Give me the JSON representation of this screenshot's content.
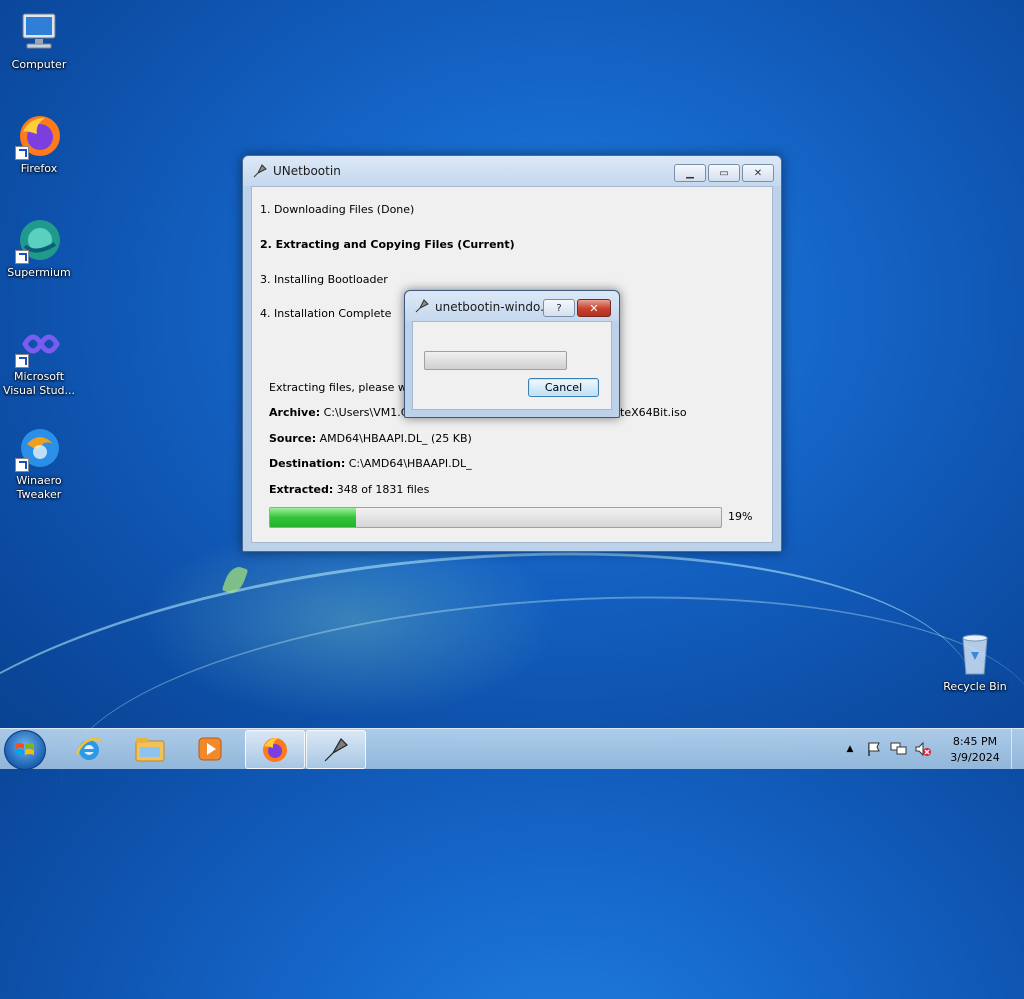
{
  "desktop": {
    "icons": [
      {
        "label": "Computer"
      },
      {
        "label": "Firefox"
      },
      {
        "label": "Supermium"
      },
      {
        "label": "Microsoft Visual Stud..."
      },
      {
        "label": "Winaero Tweaker"
      },
      {
        "label": "Recycle Bin"
      }
    ]
  },
  "main_window": {
    "title": "UNetbootin",
    "steps": [
      "1. Downloading Files (Done)",
      "2. Extracting and Copying Files (Current)",
      "3. Installing Bootloader",
      "4. Installation Complete"
    ],
    "status": "Extracting files, please wait...",
    "archive_label": "Archive:",
    "archive_value": "C:\\Users\\VM1.CO",
    "archive_tail": "teX64Bit.iso",
    "source_label": "Source:",
    "source_value": "AMD64\\HBAAPI.DL_ (25 KB)",
    "destination_label": "Destination:",
    "destination_value": "C:\\AMD64\\HBAAPI.DL_",
    "extracted_label": "Extracted:",
    "extracted_value": "348 of 1831 files",
    "progress_fraction": 0.19,
    "progress_text": "19%"
  },
  "dialog": {
    "title": "unetbootin-windo...",
    "help_symbol": "?",
    "close_symbol": "✕",
    "cancel_label": "Cancel",
    "progress_fraction": 0
  },
  "taskbar": {
    "time": "8:45 PM",
    "date": "3/9/2024"
  },
  "colors": {
    "progress_green": "#33c43a",
    "close_red": "#c7412c"
  }
}
